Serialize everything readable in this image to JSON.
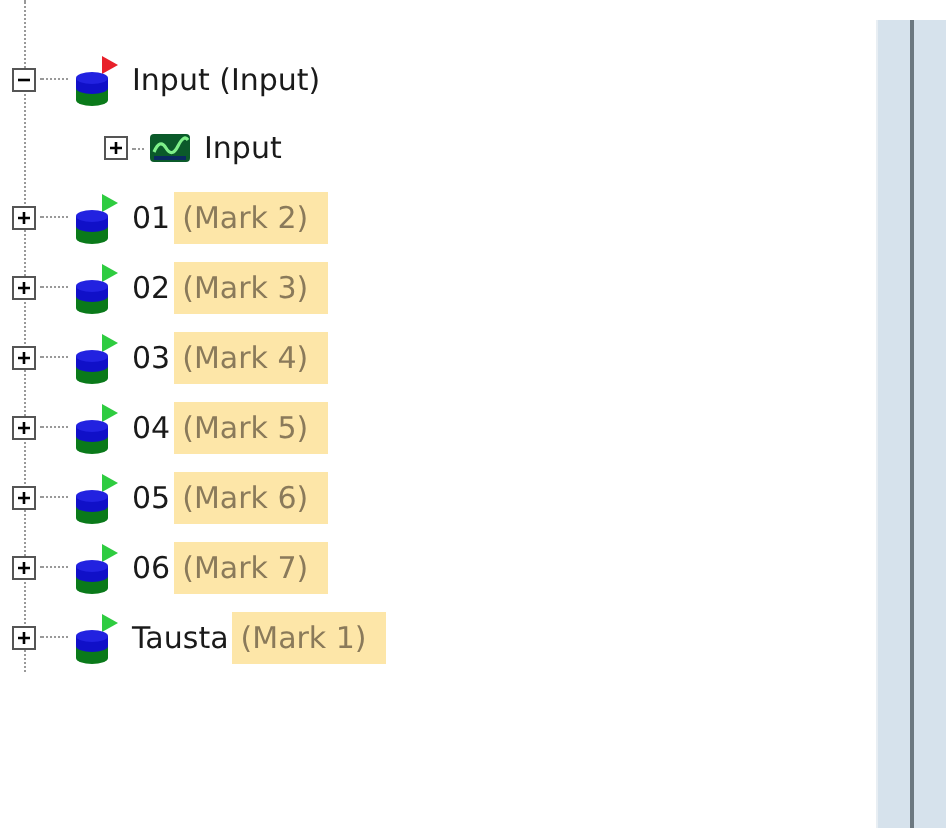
{
  "tree": [
    {
      "label": "Input (Input)",
      "kind": "cylinder",
      "color": "#e8202a",
      "expanded": true,
      "children": [
        {
          "label": "Input",
          "kind": "signal",
          "expanded": false
        }
      ]
    },
    {
      "label": "01",
      "note": "(Mark 2)",
      "kind": "cylinder",
      "color": "#2ecc40",
      "expanded": false
    },
    {
      "label": "02",
      "note": "(Mark 3)",
      "kind": "cylinder",
      "color": "#2ecc40",
      "expanded": false
    },
    {
      "label": "03",
      "note": "(Mark 4)",
      "kind": "cylinder",
      "color": "#2ecc40",
      "expanded": false
    },
    {
      "label": "04",
      "note": "(Mark 5)",
      "kind": "cylinder",
      "color": "#2ecc40",
      "expanded": false
    },
    {
      "label": "05",
      "note": "(Mark 6)",
      "kind": "cylinder",
      "color": "#2ecc40",
      "expanded": false
    },
    {
      "label": "06",
      "note": "(Mark 7)",
      "kind": "cylinder",
      "color": "#2ecc40",
      "expanded": false
    },
    {
      "label": "Tausta",
      "note": "(Mark 1)",
      "kind": "cylinder",
      "color": "#2ecc40",
      "expanded": false
    }
  ]
}
